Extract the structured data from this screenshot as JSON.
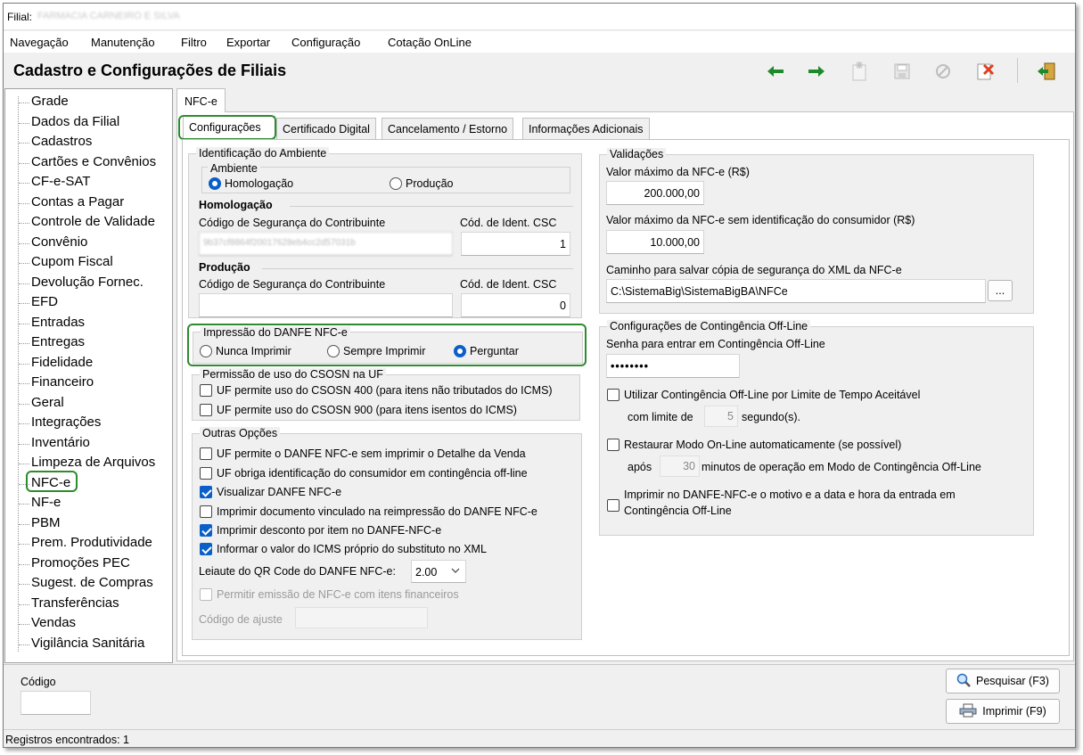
{
  "window": {
    "filial_label": "Filial:",
    "filial_value": "FARMACIA CARNEIRO E SILVA"
  },
  "menu": [
    "Navegação",
    "Manutenção",
    "Filtro",
    "Exportar",
    "Configuração",
    "Cotação OnLine"
  ],
  "header": {
    "title": "Cadastro e Configurações de Filiais"
  },
  "toolbar": {
    "icons": [
      "arrow-left-icon",
      "arrow-right-icon",
      "new-record-icon",
      "save-icon",
      "cancel-icon",
      "delete-icon",
      "exit-icon"
    ],
    "accent_green": "#1f8a2c",
    "delete_red": "#e04020"
  },
  "tree": {
    "items": [
      "Grade",
      "Dados da Filial",
      "Cadastros",
      "Cartões e Convênios",
      "CF-e-SAT",
      "Contas a Pagar",
      "Controle de Validade",
      "Convênio",
      "Cupom Fiscal",
      "Devolução Fornec.",
      "EFD",
      "Entradas",
      "Entregas",
      "Fidelidade",
      "Financeiro",
      "Geral",
      "Integrações",
      "Inventário",
      "Limpeza de Arquivos",
      "NFC-e",
      "NF-e",
      "PBM",
      "Prem. Produtividade",
      "Promoções PEC",
      "Sugest. de Compras",
      "Transferências",
      "Vendas",
      "Vigilância Sanitária"
    ],
    "selected": "NFC-e"
  },
  "top_tab": "NFC-e",
  "tabs": [
    "Configurações",
    "Certificado Digital",
    "Cancelamento / Estorno",
    "Informações Adicionais"
  ],
  "identificacao": {
    "group_title": "Identificação do Ambiente",
    "ambiente_title": "Ambiente",
    "opt_homologacao": "Homologação",
    "opt_producao": "Produção",
    "homologacao_head": "Homologação",
    "producao_head": "Produção",
    "csc_label": "Código de Segurança do Contribuinte",
    "ident_label": "Cód. de Ident. CSC",
    "homolog_csc_value": "9b37cf8864f20017628eb4cc2d57031b",
    "homolog_ident_value": "1",
    "prod_csc_value": "",
    "prod_ident_value": "0"
  },
  "impressao": {
    "title": "Impressão do DANFE NFC-e",
    "opt1": "Nunca Imprimir",
    "opt2": "Sempre Imprimir",
    "opt3": "Perguntar"
  },
  "permissao": {
    "title": "Permissão de uso do CSOSN na UF",
    "c1": "UF permite uso do CSOSN 400 (para itens não tributados do ICMS)",
    "c2": "UF permite uso do CSOSN 900 (para itens isentos do ICMS)"
  },
  "outras": {
    "title": "Outras Opções",
    "c1": "UF permite o DANFE NFC-e sem imprimir o Detalhe da Venda",
    "c2": "UF obriga identificação do consumidor em contingência off-line",
    "c3": "Visualizar DANFE NFC-e",
    "c4": "Imprimir documento vinculado na reimpressão do DANFE NFC-e",
    "c5": "Imprimir desconto por item no DANFE-NFC-e",
    "c6": "Informar o valor do ICMS próprio do substituto no XML",
    "qr_label": "Leiaute do QR Code do DANFE NFC-e:",
    "qr_value": "2.00",
    "c7": "Permitir emissão de NFC-e com itens financeiros",
    "ajuste_label": "Código de ajuste"
  },
  "validacoes": {
    "title": "Validações",
    "max_label": "Valor máximo da NFC-e (R$)",
    "max_value": "200.000,00",
    "max_sem_label": "Valor máximo da NFC-e sem identificação do consumidor (R$)",
    "max_sem_value": "10.000,00",
    "caminho_label": "Caminho para salvar cópia de segurança do XML da NFC-e",
    "caminho_value": "C:\\SistemaBig\\SistemaBigBA\\NFCe",
    "browse": "..."
  },
  "contingencia": {
    "title": "Configurações de Contingência Off-Line",
    "senha_label": "Senha para entrar em Contingência Off-Line",
    "senha_value": "••••••••",
    "c1": "Utilizar Contingência Off-Line por Limite de Tempo Aceitável",
    "limite_pre": "com limite de",
    "limite_value": "5",
    "limite_post": "segundo(s).",
    "c2": "Restaurar Modo On-Line automaticamente (se possível)",
    "apos_pre": "após",
    "apos_value": "30",
    "apos_post": "minutos de operação em Modo de Contingência Off-Line",
    "c3_line1": "Imprimir no DANFE-NFC-e o motivo e a data e hora da entrada em",
    "c3_line2": "Contingência Off-Line"
  },
  "bottom": {
    "codigo_label": "Código",
    "codigo_value": "",
    "pesquisar": "Pesquisar (F3)",
    "imprimir": "Imprimir (F9)"
  },
  "status": {
    "text": "Registros encontrados: 1"
  }
}
